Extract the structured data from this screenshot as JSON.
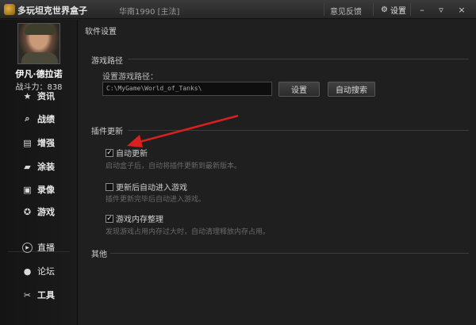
{
  "titlebar": {
    "app_title": "多玩坦克世界盒子",
    "server": "华南1990 [主法]",
    "feedback": "意见反馈",
    "settings": "设置",
    "minimize": "–",
    "menu": "▿",
    "close": "×"
  },
  "sidebar": {
    "player_name": "伊凡·德拉诺",
    "power": "战斗力：838",
    "items": [
      {
        "label": "资讯",
        "icon": "star-icon",
        "glyph": "★"
      },
      {
        "label": "战绩",
        "icon": "magnifier-icon",
        "glyph": "🔍"
      },
      {
        "label": "增强",
        "icon": "toolbox-icon",
        "glyph": "▤"
      },
      {
        "label": "涂装",
        "icon": "paint-icon",
        "glyph": "▰"
      },
      {
        "label": "录像",
        "icon": "film-icon",
        "glyph": "▣"
      },
      {
        "label": "游戏",
        "icon": "gamepad-icon",
        "glyph": "✪"
      },
      {
        "label": "直播",
        "icon": "play-icon",
        "glyph": "▶"
      },
      {
        "label": "论坛",
        "icon": "chat-icon",
        "glyph": "●"
      },
      {
        "label": "工具",
        "icon": "tools-icon",
        "glyph": "✂"
      }
    ]
  },
  "main": {
    "page_title": "软件设置",
    "section_path": "游戏路径",
    "path_label": "设置游戏路径：",
    "path_value": "C:\\MyGame\\World_of_Tanks\\",
    "set_button": "设置",
    "auto_search_button": "自动搜索",
    "section_plugin": "插件更新",
    "options": [
      {
        "label": "自动更新",
        "checked": true,
        "desc": "启动盒子后，自动将插件更新到最新版本。"
      },
      {
        "label": "更新后自动进入游戏",
        "checked": false,
        "desc": "插件更新完毕后自动进入游戏。"
      },
      {
        "label": "游戏内存整理",
        "checked": true,
        "desc": "发现游戏占用内存过大时，自动清理释放内存占用。"
      }
    ],
    "section_other": "其他"
  },
  "colors": {
    "accent_arrow": "#d8201e",
    "background": "#1f1f1f",
    "sidebar": "#161616"
  }
}
